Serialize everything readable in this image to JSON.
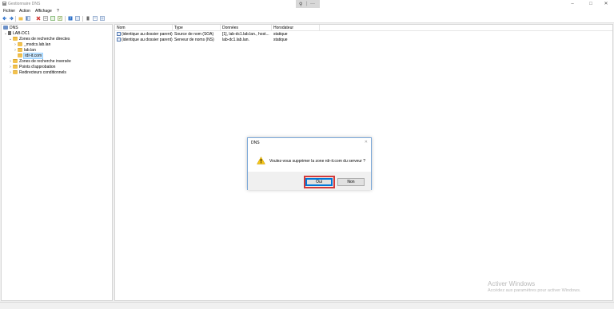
{
  "window": {
    "title": "Gestionnaire DNS",
    "controls": {
      "minimize": "–",
      "maximize": "□",
      "close": "✕"
    }
  },
  "zoom_toolbar": {
    "zoom_icon": "⚲",
    "separator": "|",
    "more": "···"
  },
  "menu": {
    "items": [
      "Fichier",
      "Action",
      "Affichage",
      "?"
    ]
  },
  "toolbar": {
    "icons": [
      "back-icon",
      "forward-icon",
      "up-icon",
      "show-tree-icon",
      "delete-icon",
      "properties-icon",
      "refresh-icon",
      "export-icon",
      "help-icon",
      "view-icon",
      "server-icon",
      "record-icon",
      "zone-icon"
    ]
  },
  "tree": {
    "root": "DNS",
    "server": "LAB-DC1",
    "forward_zones": "Zones de recherche directes",
    "forward_children": [
      "_msdcs.lab.lan",
      "lab.lan",
      "rdr-it.com"
    ],
    "reverse_zones": "Zones de recherche inversée",
    "trust_points": "Points d'approbation",
    "conditional_forwarders": "Redirecteurs conditionnels"
  },
  "list": {
    "columns": [
      "Nom",
      "Type",
      "Données",
      "Horodateur"
    ],
    "rows": [
      {
        "name": "(identique au dossier parent)",
        "type": "Source de nom (SOA)",
        "data": "[1], lab-dc1.lab.lan., host...",
        "timestamp": "statique"
      },
      {
        "name": "(identique au dossier parent)",
        "type": "Serveur de noms (NS)",
        "data": "lab-dc1.lab.lan.",
        "timestamp": "statique"
      }
    ]
  },
  "dialog": {
    "title": "DNS",
    "close": "✕",
    "message": "Voulez-vous supprimer la zone rdr-it.com du serveur ?",
    "yes_label": "Oui",
    "no_label": "Non"
  },
  "watermark": {
    "line1": "Activer Windows",
    "line2": "Accédez aux paramètres pour activer Windows."
  }
}
